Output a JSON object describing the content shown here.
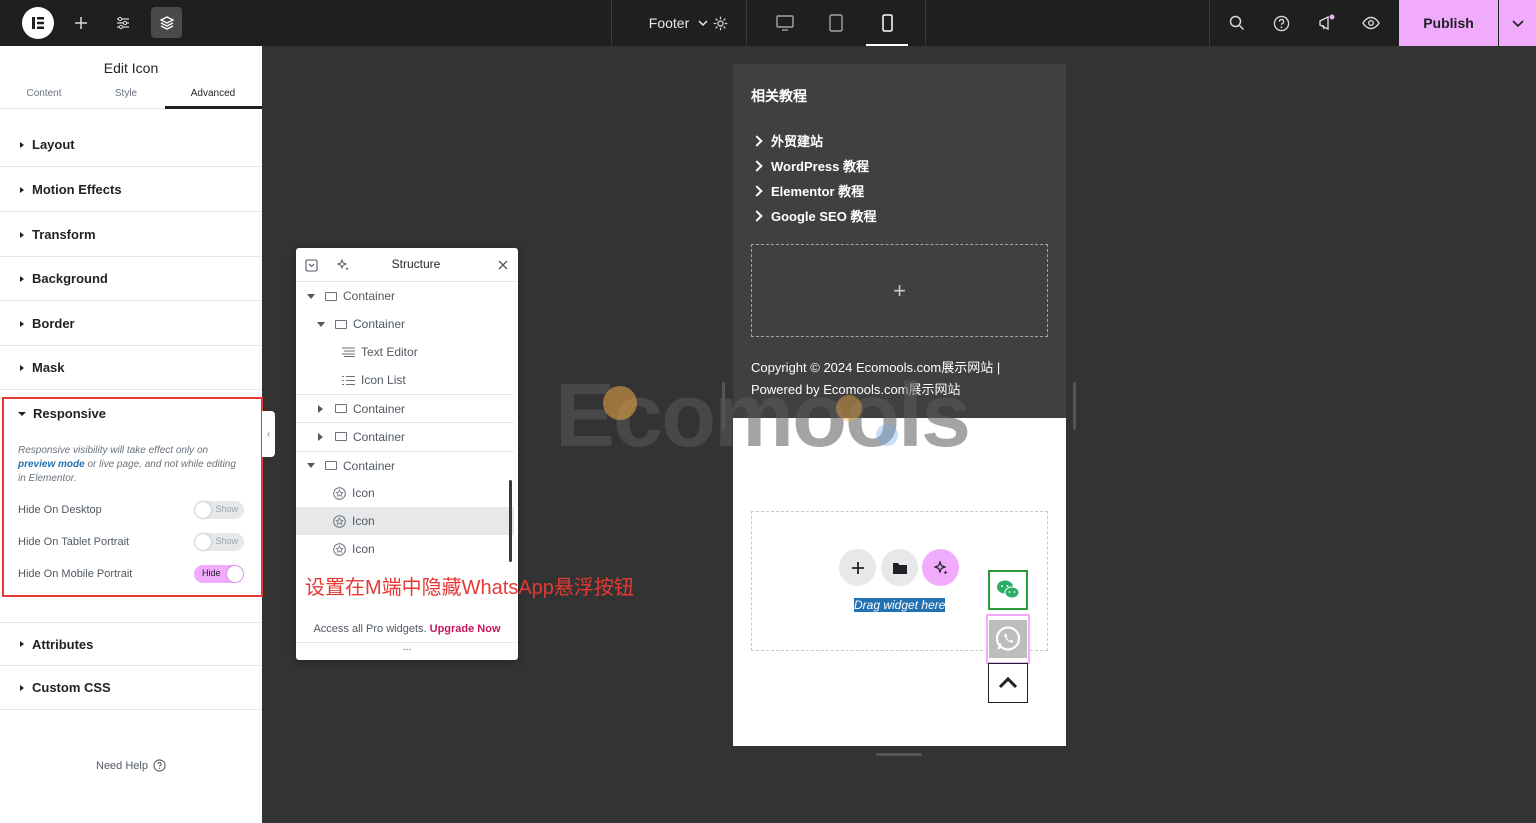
{
  "topbar": {
    "template_label": "Footer",
    "publish_label": "Publish"
  },
  "panel": {
    "title": "Edit Icon",
    "tabs": [
      "Content",
      "Style",
      "Advanced"
    ],
    "sections": [
      "Layout",
      "Motion Effects",
      "Transform",
      "Background",
      "Border",
      "Mask"
    ],
    "responsive": {
      "title": "Responsive",
      "note_pre": "Responsive visibility will take effect only on ",
      "note_link": "preview mode",
      "note_post": " or live page, and not while editing in Elementor.",
      "rows": [
        {
          "label": "Hide On Desktop",
          "toggle": "Show"
        },
        {
          "label": "Hide On Tablet Portrait",
          "toggle": "Show"
        },
        {
          "label": "Hide On Mobile Portrait",
          "toggle": "Hide"
        }
      ]
    },
    "sections_after": [
      "Attributes",
      "Custom CSS"
    ],
    "need_help": "Need Help"
  },
  "structure": {
    "title": "Structure",
    "items": [
      "Container",
      "Container",
      "Text Editor",
      "Icon List",
      "Container",
      "Container",
      "Container",
      "Icon",
      "Icon",
      "Icon"
    ],
    "annotation": "设置在M端中隐藏WhatsApp悬浮按钮",
    "footer_text": "Access all Pro widgets.",
    "footer_link": "Upgrade Now",
    "dots": "..."
  },
  "canvas": {
    "heading": "相关教程",
    "links": [
      "外贸建站",
      "WordPress 教程",
      "Elementor 教程",
      "Google SEO 教程"
    ],
    "add_symbol": "+",
    "copyright_line1": "Copyright © 2024 Ecomools.com展示网站 |",
    "copyright_line2": "Powered by Ecomools.com展示网站",
    "drag_highlight": "Drag",
    "drag_rest": " widget here",
    "watermark": "Ecomools"
  },
  "colors": {
    "accent": "#f0abfc",
    "highlight_border": "#e53935",
    "topbar": "#1f1f1f",
    "canvas_bg": "#333333"
  }
}
